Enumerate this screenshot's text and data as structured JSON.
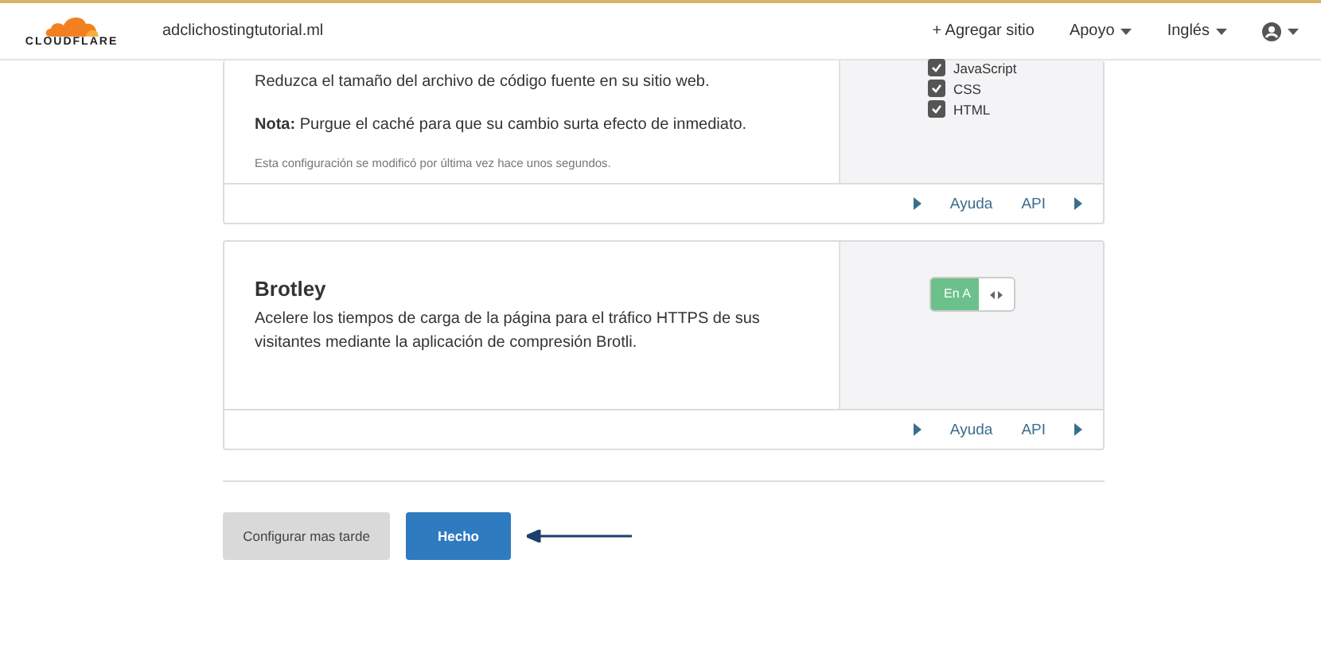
{
  "header": {
    "logo": "CLOUDFLARE",
    "site": "adclichostingtutorial.ml",
    "nav": [
      {
        "label": "+ Agregar sitio",
        "caret": false
      },
      {
        "label": "Apoyo",
        "caret": true
      },
      {
        "label": "Inglés",
        "caret": true
      }
    ]
  },
  "cards": [
    {
      "kind": "checks",
      "paragraphs": [
        "Reduzca el tamaño del archivo de código fuente en su sitio web.",
        "**Nota:** Purgue el caché para que su cambio surta efecto de inmediato."
      ],
      "note": "Esta configuración se modificó por última vez hace unos segundos.",
      "options": [
        {
          "label": "JavaScript",
          "checked": true
        },
        {
          "label": "CSS",
          "checked": true
        },
        {
          "label": "HTML",
          "checked": true
        }
      ],
      "footer": {
        "help": "Ayuda",
        "api": "API"
      }
    },
    {
      "kind": "toggle",
      "title": "Brotley",
      "paragraphs": [
        "Acelere los tiempos de carga de la página para el tráfico HTTPS de sus visitantes mediante la aplicación de compresión Brotli."
      ],
      "toggle": {
        "label": "En A",
        "on": true
      },
      "footer": {
        "help": "Ayuda",
        "api": "API"
      }
    }
  ],
  "buttons": [
    {
      "label": "Configurar mas tarde",
      "kind": "secondary"
    },
    {
      "label": "Hecho",
      "kind": "primary"
    }
  ]
}
